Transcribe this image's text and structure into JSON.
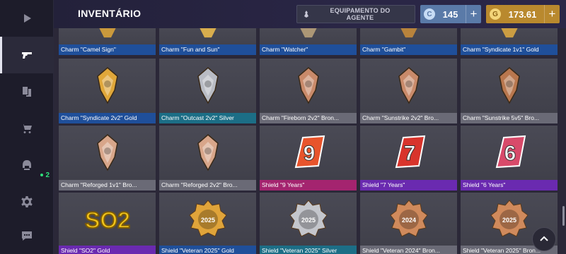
{
  "header": {
    "title": "INVENTÁRIO",
    "agent_button": "EQUIPAMENTO DO AGENTE",
    "currency_blue": {
      "value": "145",
      "icon": "c-coin-icon"
    },
    "currency_gold": {
      "value": "173.61",
      "icon": "g-coin-icon"
    }
  },
  "sidebar": {
    "items": [
      {
        "icon": "play-icon",
        "active": false
      },
      {
        "icon": "pistol-icon",
        "active": true
      },
      {
        "icon": "cards-icon",
        "active": false
      },
      {
        "icon": "cart-icon",
        "active": false
      },
      {
        "icon": "helmet-icon",
        "active": false,
        "badge": "2"
      },
      {
        "icon": "gear-icon",
        "active": false
      },
      {
        "icon": "chat-icon",
        "active": false
      }
    ]
  },
  "items": [
    {
      "name": "Charm \"Camel Sign\"",
      "rarity": "blue",
      "color": "#d8a23a"
    },
    {
      "name": "Charm \"Fun and Sun\"",
      "rarity": "blue",
      "color": "#e8b84c"
    },
    {
      "name": "Charm \"Watcher\"",
      "rarity": "blue",
      "color": "#b7a07a"
    },
    {
      "name": "Charm \"Gambit\"",
      "rarity": "blue",
      "color": "#c48a3a"
    },
    {
      "name": "Charm \"Syndicate 1v1\" Gold",
      "rarity": "blue",
      "color": "#d9a640"
    },
    {
      "name": "Charm \"Syndicate 2v2\" Gold",
      "rarity": "blue",
      "color": "#e0a73a"
    },
    {
      "name": "Charm \"Outcast 2v2\" Silver",
      "rarity": "teal",
      "color": "#b9bcc4"
    },
    {
      "name": "Charm \"Fireborn 2v2\" Bron...",
      "rarity": "gray",
      "color": "#c98a6a"
    },
    {
      "name": "Charm \"Sunstrike 2v2\" Bro...",
      "rarity": "gray",
      "color": "#c98a6a"
    },
    {
      "name": "Charm \"Sunstrike 5v5\" Bro...",
      "rarity": "gray",
      "color": "#b9774e"
    },
    {
      "name": "Charm \"Reforged 1v1\" Bro...",
      "rarity": "gray",
      "color": "#d8a68a"
    },
    {
      "name": "Charm \"Reforged 2v2\" Bro...",
      "rarity": "gray",
      "color": "#d8a68a"
    },
    {
      "name": "Shield \"9 Years\"",
      "rarity": "pink",
      "color": "#e8542c"
    },
    {
      "name": "Shield \"7 Years\"",
      "rarity": "purple",
      "color": "#d8342c"
    },
    {
      "name": "Shield \"6 Years\"",
      "rarity": "purple",
      "color": "#d84a6a"
    },
    {
      "name": "Shield \"SO2\" Gold",
      "rarity": "purple",
      "color": "#f2c418"
    },
    {
      "name": "Shield \"Veteran 2025\" Gold",
      "rarity": "blue",
      "color": "#e0a43a"
    },
    {
      "name": "Shield \"Veteran 2025\" Silver",
      "rarity": "teal",
      "color": "#c4c6cc"
    },
    {
      "name": "Shield \"Veteran 2024\" Bron...",
      "rarity": "gray",
      "color": "#d08a5c"
    },
    {
      "name": "Shield \"Veteran 2025\" Bron...",
      "rarity": "gray",
      "color": "#d08a5c"
    }
  ],
  "art_labels": {
    "so2": "SO2",
    "y2025": "2025",
    "y2024": "2024",
    "nine": "9",
    "seven": "7",
    "six": "6"
  }
}
